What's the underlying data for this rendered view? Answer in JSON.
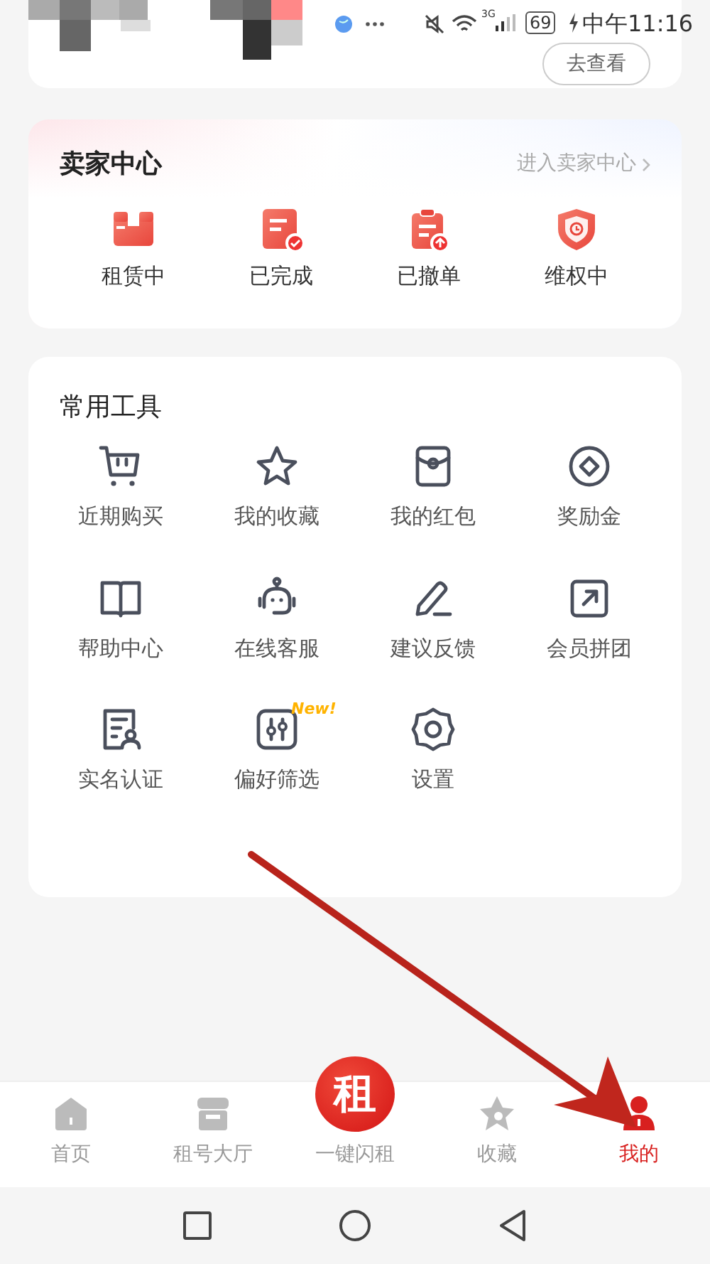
{
  "status_bar": {
    "network": "3G",
    "battery": "69",
    "time": "中午11:16"
  },
  "top_card": {
    "button": "去查看"
  },
  "seller_center": {
    "title": "卖家中心",
    "link": "进入卖家中心",
    "items": [
      {
        "label": "租赁中"
      },
      {
        "label": "已完成"
      },
      {
        "label": "已撤单"
      },
      {
        "label": "维权中"
      }
    ]
  },
  "tools": {
    "title": "常用工具",
    "items": [
      {
        "label": "近期购买"
      },
      {
        "label": "我的收藏"
      },
      {
        "label": "我的红包"
      },
      {
        "label": "奖励金"
      },
      {
        "label": "帮助中心"
      },
      {
        "label": "在线客服"
      },
      {
        "label": "建议反馈"
      },
      {
        "label": "会员拼团"
      },
      {
        "label": "实名认证"
      },
      {
        "label": "偏好筛选",
        "badge": "New!"
      },
      {
        "label": "设置"
      }
    ]
  },
  "bottom_nav": {
    "items": [
      {
        "kind": "tab",
        "label": "首页",
        "selected": false
      },
      {
        "kind": "tab",
        "label": "租号大厅",
        "selected": false
      },
      {
        "kind": "center",
        "emblem": "租",
        "label": "一键闪租",
        "selected": false
      },
      {
        "kind": "tab",
        "label": "收藏",
        "selected": false
      },
      {
        "kind": "tab",
        "label": "我的",
        "selected": true
      }
    ]
  }
}
